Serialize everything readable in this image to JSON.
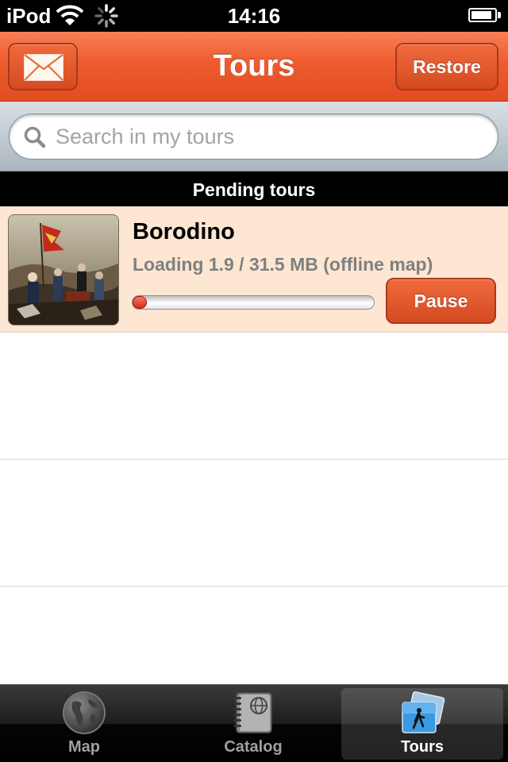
{
  "status_bar": {
    "carrier": "iPod",
    "time": "14:16",
    "battery_level": 0.9
  },
  "nav_bar": {
    "title": "Tours",
    "restore_label": "Restore",
    "left_icon": "mail-icon"
  },
  "search": {
    "placeholder": "Search in my tours",
    "value": ""
  },
  "section": {
    "header": "Pending tours"
  },
  "tours": [
    {
      "title": "Borodino",
      "status": "Loading 1.9 / 31.5 MB (offline map)",
      "loaded_mb": 1.9,
      "total_mb": 31.5,
      "progress": 0.06,
      "action_label": "Pause"
    }
  ],
  "tab_bar": {
    "tabs": [
      {
        "label": "Map",
        "icon": "globe-icon",
        "selected": false
      },
      {
        "label": "Catalog",
        "icon": "catalog-icon",
        "selected": false
      },
      {
        "label": "Tours",
        "icon": "tours-icon",
        "selected": true
      }
    ]
  },
  "colors": {
    "accent": "#ee5b2f",
    "row_highlight": "#fde6d2",
    "progress_fill": "#d9261c"
  }
}
